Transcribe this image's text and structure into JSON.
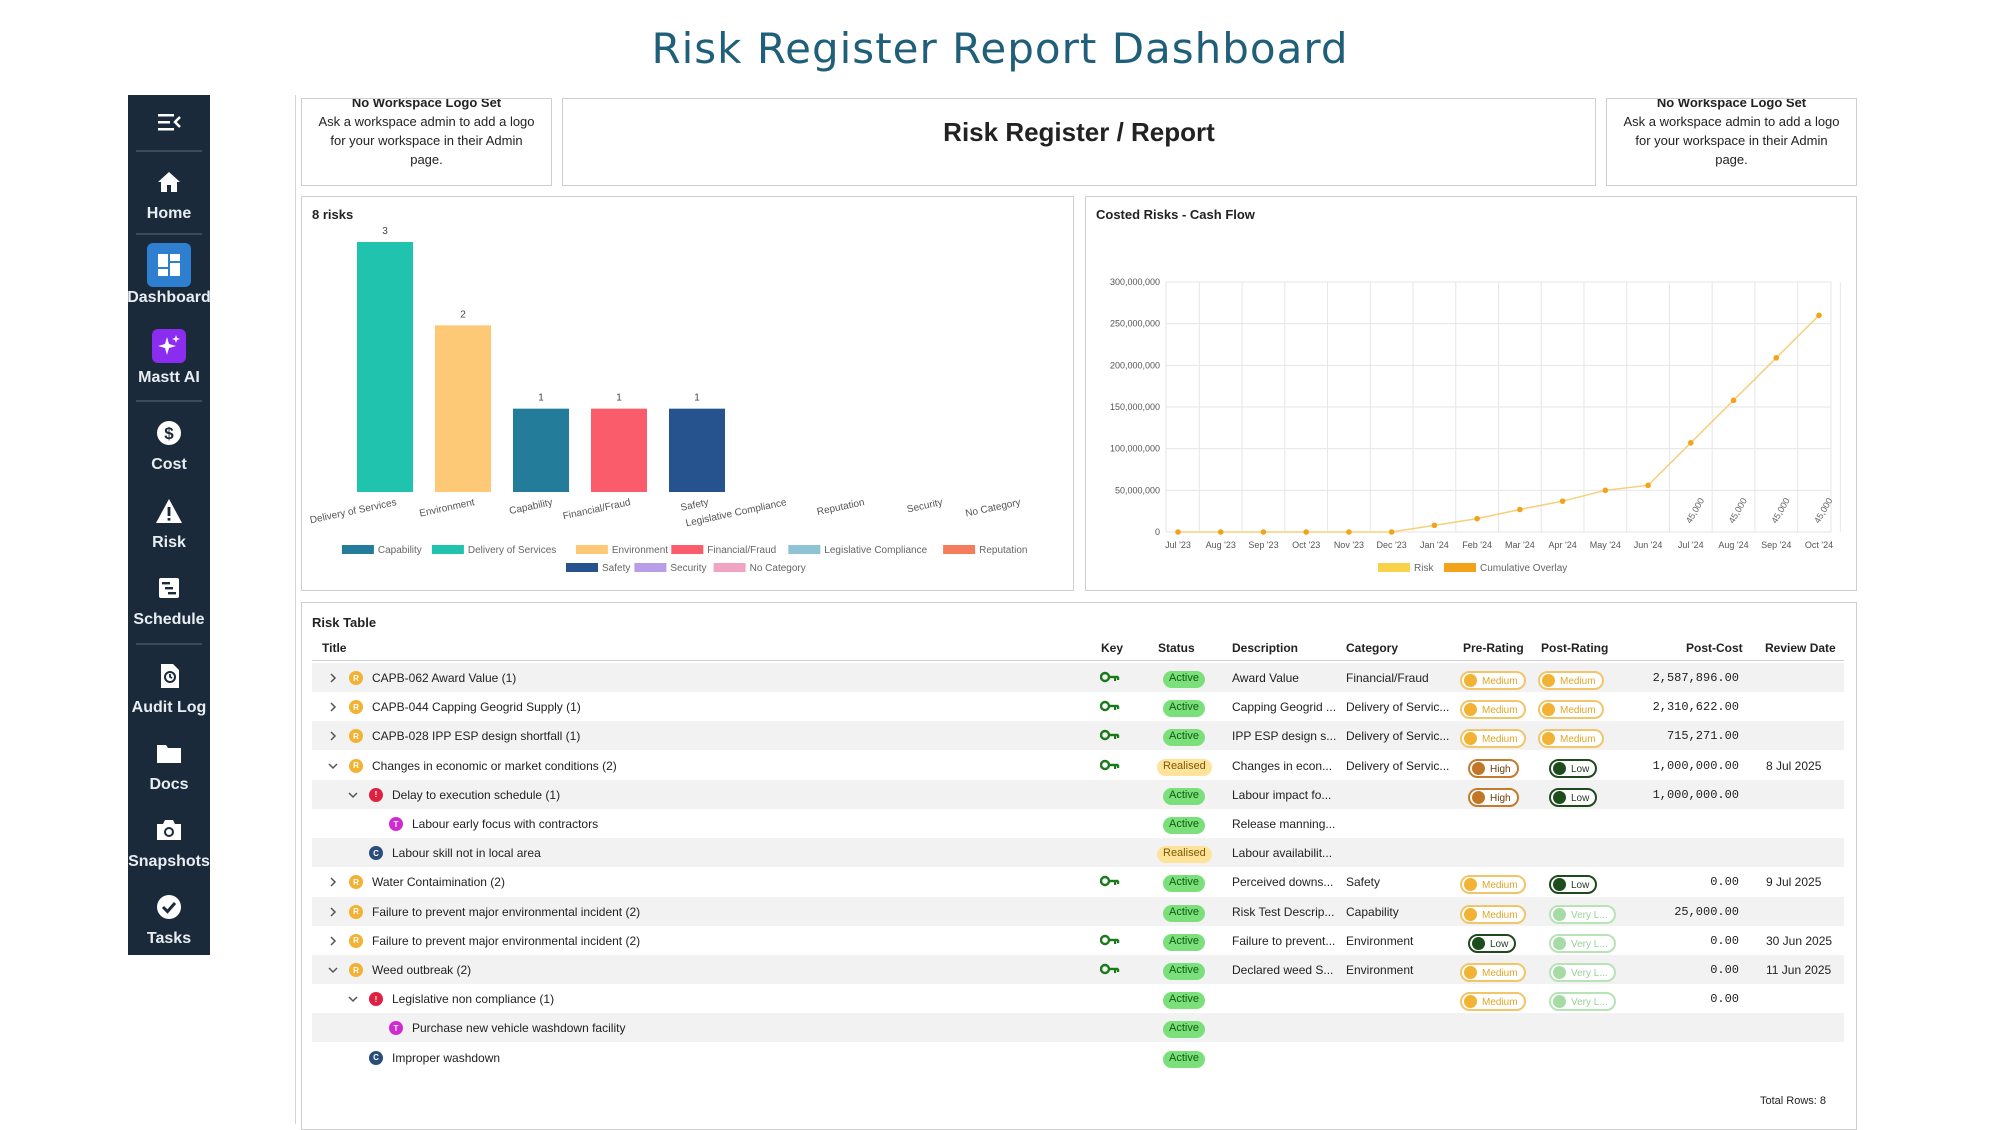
{
  "page_title": "Risk Register Report Dashboard",
  "sidebar": {
    "items": [
      {
        "label": "Home",
        "icon": "home-icon"
      },
      {
        "label": "Dashboard",
        "icon": "dashboard-icon"
      },
      {
        "label": "Mastt AI",
        "icon": "sparkle-icon"
      },
      {
        "label": "Cost",
        "icon": "dollar-icon"
      },
      {
        "label": "Risk",
        "icon": "warning-icon"
      },
      {
        "label": "Schedule",
        "icon": "schedule-icon"
      },
      {
        "label": "Audit Log",
        "icon": "history-icon"
      },
      {
        "label": "Docs",
        "icon": "folder-icon"
      },
      {
        "label": "Snapshots",
        "icon": "camera-icon"
      },
      {
        "label": "Tasks",
        "icon": "check-icon"
      }
    ]
  },
  "header": {
    "logo_left": {
      "title": "No Workspace Logo Set",
      "text": "Ask a workspace admin to add a logo for your workspace in their Admin page."
    },
    "report_title": "Risk Register / Report",
    "logo_right": {
      "title": "No Workspace Logo Set",
      "text": "Ask a workspace admin to add a logo for your workspace in their Admin page."
    }
  },
  "chart_data": [
    {
      "type": "bar",
      "title": "8 risks",
      "categories": [
        "Delivery of Services",
        "Environment",
        "Capability",
        "Financial/Fraud",
        "Safety",
        "Legislative Compliance",
        "Reputation",
        "Security",
        "No Category"
      ],
      "values": [
        3,
        2,
        1,
        1,
        1,
        0,
        0,
        0,
        0
      ],
      "colors": [
        "#20c4ae",
        "#fec977",
        "#237c9a",
        "#fa5c6b",
        "#26538d",
        "#8ec3d6",
        "#f47c5b",
        "#b89ee6",
        "#f0a3c3"
      ],
      "legend": [
        "Capability",
        "Delivery of Services",
        "Environment",
        "Financial/Fraud",
        "Legislative Compliance",
        "Reputation",
        "Safety",
        "Security",
        "No Category"
      ],
      "legend_colors": [
        "#237c9a",
        "#20c4ae",
        "#fec977",
        "#fa5c6b",
        "#8ec3d6",
        "#f47c5b",
        "#26538d",
        "#b89ee6",
        "#f0a3c3"
      ],
      "legend_position": "bottom"
    },
    {
      "type": "line",
      "title": "Costed Risks - Cash Flow",
      "x": [
        "Jul '23",
        "Aug '23",
        "Sep '23",
        "Oct '23",
        "Nov '23",
        "Dec '23",
        "Jan '24",
        "Feb '24",
        "Mar '24",
        "Apr '24",
        "May '24",
        "Jun '24",
        "Jul '24",
        "Aug '24",
        "Sep '24",
        "Oct '24"
      ],
      "series": [
        {
          "name": "Risk",
          "color": "#f7d24a",
          "values": [
            0,
            0,
            0,
            0,
            0,
            0,
            0,
            0,
            0,
            0,
            0,
            0,
            45000,
            45000,
            45000,
            45000
          ]
        },
        {
          "name": "Cumulative Overlay",
          "color": "#f2a31a",
          "values": [
            0,
            0,
            0,
            0,
            0,
            0,
            8000000,
            16000000,
            27000000,
            37000000,
            50000000,
            56000000,
            107000000,
            158000000,
            209000000,
            260000000
          ]
        }
      ],
      "point_labels": [
        "45,000",
        "45,000",
        "45,000",
        "45,000"
      ],
      "y_ticks": [
        "0",
        "50,000,000",
        "100,000,000",
        "150,000,000",
        "200,000,000",
        "250,000,000",
        "300,000,000"
      ],
      "ylim": [
        0,
        300000000
      ],
      "grid": true,
      "legend_position": "bottom"
    }
  ],
  "table": {
    "title": "Risk Table",
    "columns": {
      "title": "Title",
      "key": "Key",
      "status": "Status",
      "description": "Description",
      "category": "Category",
      "pre": "Pre-Rating",
      "post": "Post-Rating",
      "cost": "Post-Cost",
      "review": "Review Date"
    },
    "rows": [
      {
        "level": 0,
        "chevron": ">",
        "dot": "R",
        "dot_color": "#f2b233",
        "title": "CAPB-062 Award Value  (1)",
        "key": true,
        "status": "Active",
        "desc": "Award Value",
        "cat": "Financial/Fraud",
        "pre": "Medium",
        "post": "Medium",
        "cost": "2,587,896.00",
        "review": ""
      },
      {
        "level": 0,
        "chevron": ">",
        "dot": "R",
        "dot_color": "#f2b233",
        "title": "CAPB-044 Capping Geogrid Supply  (1)",
        "key": true,
        "status": "Active",
        "desc": "Capping Geogrid ...",
        "cat": "Delivery of Servic...",
        "pre": "Medium",
        "post": "Medium",
        "cost": "2,310,622.00",
        "review": ""
      },
      {
        "level": 0,
        "chevron": ">",
        "dot": "R",
        "dot_color": "#f2b233",
        "title": "CAPB-028 IPP ESP design shortfall  (1)",
        "key": true,
        "status": "Active",
        "desc": "IPP ESP design s...",
        "cat": "Delivery of Servic...",
        "pre": "Medium",
        "post": "Medium",
        "cost": "715,271.00",
        "review": ""
      },
      {
        "level": 0,
        "chevron": "v",
        "dot": "R",
        "dot_color": "#f2b233",
        "title": "Changes in economic or market conditions  (2)",
        "key": true,
        "status": "Realised",
        "desc": "Changes in econ...",
        "cat": "Delivery of Servic...",
        "pre": "High",
        "post": "Low",
        "cost": "1,000,000.00",
        "review": "8 Jul 2025"
      },
      {
        "level": 1,
        "chevron": "v",
        "dot": "!",
        "dot_color": "#e02040",
        "title": "Delay to execution schedule  (1)",
        "key": false,
        "status": "Active",
        "desc": "Labour impact fo...",
        "cat": "",
        "pre": "High",
        "post": "Low",
        "cost": "1,000,000.00",
        "review": ""
      },
      {
        "level": 2,
        "chevron": "",
        "dot": "T",
        "dot_color": "#d02ad0",
        "title": "Labour early focus with contractors",
        "key": false,
        "status": "Active",
        "desc": "Release manning...",
        "cat": "",
        "pre": "",
        "post": "",
        "cost": "",
        "review": ""
      },
      {
        "level": 1,
        "chevron": "",
        "dot": "C",
        "dot_color": "#2a4d7a",
        "title": "Labour skill not in local area",
        "key": false,
        "status": "Realised",
        "desc": "Labour availabilit...",
        "cat": "",
        "pre": "",
        "post": "",
        "cost": "",
        "review": ""
      },
      {
        "level": 0,
        "chevron": ">",
        "dot": "R",
        "dot_color": "#f2b233",
        "title": "Water Contaimination  (2)",
        "key": true,
        "status": "Active",
        "desc": "Perceived downs...",
        "cat": "Safety",
        "pre": "Medium",
        "post": "Low",
        "cost": "0.00",
        "review": "9 Jul 2025"
      },
      {
        "level": 0,
        "chevron": ">",
        "dot": "R",
        "dot_color": "#f2b233",
        "title": "Failure to prevent major environmental incident  (2)",
        "key": false,
        "status": "Active",
        "desc": "Risk Test Descrip...",
        "cat": "Capability",
        "pre": "Medium",
        "post": "Very L...",
        "cost": "25,000.00",
        "review": ""
      },
      {
        "level": 0,
        "chevron": ">",
        "dot": "R",
        "dot_color": "#f2b233",
        "title": "Failure to prevent major environmental incident  (2)",
        "key": true,
        "status": "Active",
        "desc": "Failure to prevent...",
        "cat": "Environment",
        "pre": "Low",
        "post": "Very L...",
        "cost": "0.00",
        "review": "30 Jun 2025"
      },
      {
        "level": 0,
        "chevron": "v",
        "dot": "R",
        "dot_color": "#f2b233",
        "title": "Weed outbreak  (2)",
        "key": true,
        "status": "Active",
        "desc": "Declared weed S...",
        "cat": "Environment",
        "pre": "Medium",
        "post": "Very L...",
        "cost": "0.00",
        "review": "11 Jun 2025"
      },
      {
        "level": 1,
        "chevron": "v",
        "dot": "!",
        "dot_color": "#e02040",
        "title": "Legislative non compliance  (1)",
        "key": false,
        "status": "Active",
        "desc": "",
        "cat": "",
        "pre": "Medium",
        "post": "Very L...",
        "cost": "0.00",
        "review": ""
      },
      {
        "level": 2,
        "chevron": "",
        "dot": "T",
        "dot_color": "#d02ad0",
        "title": "Purchase new vehicle washdown facility",
        "key": false,
        "status": "Active",
        "desc": "",
        "cat": "",
        "pre": "",
        "post": "",
        "cost": "",
        "review": ""
      },
      {
        "level": 1,
        "chevron": "",
        "dot": "C",
        "dot_color": "#2a4d7a",
        "title": "Improper washdown",
        "key": false,
        "status": "Active",
        "desc": "",
        "cat": "",
        "pre": "",
        "post": "",
        "cost": "",
        "review": ""
      }
    ],
    "total_rows": "Total Rows: 8"
  }
}
